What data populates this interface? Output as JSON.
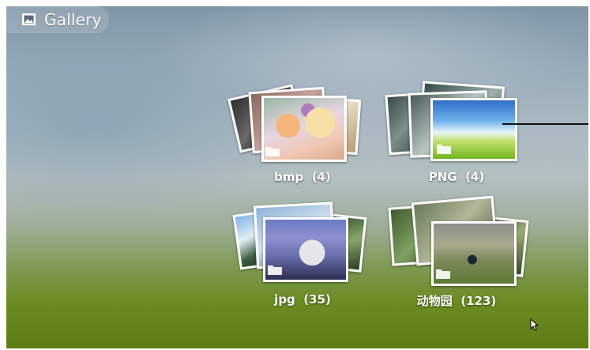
{
  "app": {
    "title": "Gallery",
    "icon": "gallery-icon"
  },
  "albums": [
    {
      "name": "bmp",
      "count": "(4)",
      "label": "bmp  (4)"
    },
    {
      "name": "PNG",
      "count": "(4)",
      "label": "PNG  (4)"
    },
    {
      "name": "jpg",
      "count": "(35)",
      "label": "jpg  (35)"
    },
    {
      "name": "动物园",
      "count": "(123)",
      "label": "动物园  (123)"
    }
  ],
  "icons": {
    "folder": "folder-icon",
    "cursor": "mouse-pointer-icon"
  }
}
